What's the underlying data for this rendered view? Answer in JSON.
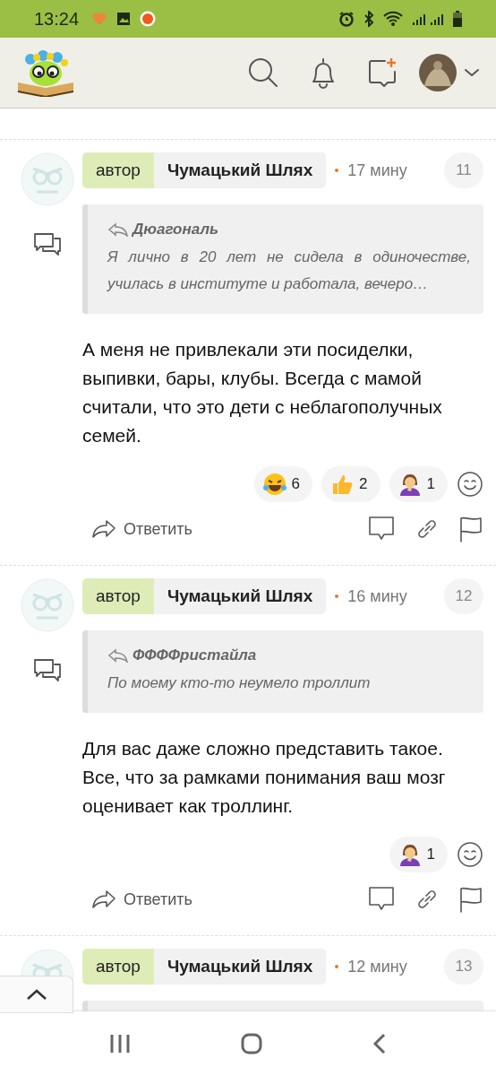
{
  "status_bar": {
    "time": "13:24"
  },
  "comments": [
    {
      "badge": "автор",
      "author": "Чумацький Шлях",
      "time": "17 мину",
      "number": "11",
      "quote": {
        "author": "Дюагональ",
        "text": "Я лично в 20 лет не сидела в одиночестве, училась в институте и работала, вечеро…"
      },
      "body": "А меня не привлекали эти посиделки, выпивки, бары, клубы. Всегда с мамой считали, что это дети с неблагополучных семей.",
      "reactions": [
        {
          "kind": "laugh",
          "count": "6"
        },
        {
          "kind": "thumb",
          "count": "2"
        },
        {
          "kind": "facepalm",
          "count": "1"
        }
      ],
      "reply": "Ответить"
    },
    {
      "badge": "автор",
      "author": "Чумацький Шлях",
      "time": "16 мину",
      "number": "12",
      "quote": {
        "author": "ФФФФристайла",
        "text": "По моему кто-то неумело троллит"
      },
      "body": "Для вас даже сложно представить такое. Все, что за рамками понимания ваш мозг оценивает как троллинг.",
      "reactions": [
        {
          "kind": "facepalm",
          "count": "1"
        }
      ],
      "reply": "Ответить"
    },
    {
      "badge": "автор",
      "author": "Чумацький Шлях",
      "time": "12 мину",
      "number": "13"
    }
  ]
}
